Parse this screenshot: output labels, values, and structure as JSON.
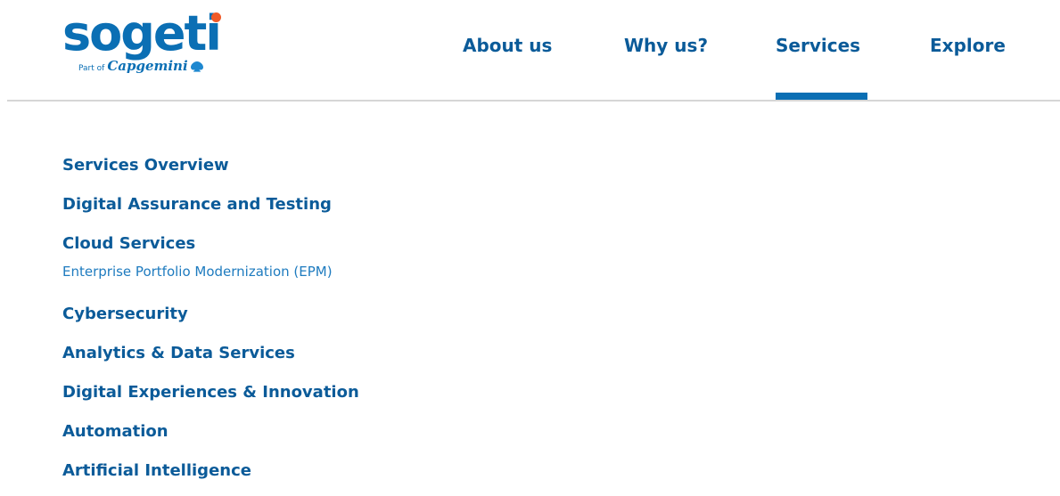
{
  "brand": {
    "name": "sogeti",
    "part_of": "Part of",
    "parent": "Capgemini",
    "colors": {
      "primary": "#0b6fb4",
      "nav_text": "#0b5b99",
      "dot": "#f05a28"
    }
  },
  "nav": {
    "items": [
      {
        "label": "About us"
      },
      {
        "label": "Why us?"
      },
      {
        "label": "Services",
        "active": true
      },
      {
        "label": "Explore"
      }
    ]
  },
  "menu": {
    "items": [
      {
        "label": "Services Overview"
      },
      {
        "label": "Digital Assurance and Testing"
      },
      {
        "label": "Cloud Services"
      },
      {
        "label": "Enterprise Portfolio Modernization (EPM)",
        "sub": true
      },
      {
        "label": "Cybersecurity"
      },
      {
        "label": "Analytics & Data Services"
      },
      {
        "label": "Digital Experiences & Innovation"
      },
      {
        "label": "Automation"
      },
      {
        "label": "Artificial Intelligence"
      }
    ]
  }
}
